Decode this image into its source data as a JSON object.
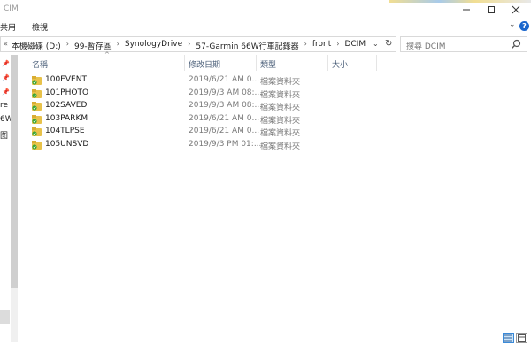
{
  "window": {
    "title": "CIM"
  },
  "ribbon": {
    "tabs": [
      "共用",
      "檢視"
    ]
  },
  "address": {
    "crumbs": [
      "本機磁碟 (D:)",
      "99-暫存區",
      "SynologyDrive",
      "57-Garmin 66W行車記錄器",
      "front",
      "DCIM"
    ]
  },
  "search": {
    "placeholder": "搜尋 DCIM"
  },
  "nav": {
    "labels": [
      "re",
      "6W",
      "图"
    ]
  },
  "columns": {
    "name": "名稱",
    "date": "修改日期",
    "type": "類型",
    "size": "大小"
  },
  "files": [
    {
      "name": "100EVENT",
      "date": "2019/6/21 AM 0...",
      "type": "檔案資料夾"
    },
    {
      "name": "101PHOTO",
      "date": "2019/9/3 AM 08:...",
      "type": "檔案資料夾"
    },
    {
      "name": "102SAVED",
      "date": "2019/9/3 AM 08:...",
      "type": "檔案資料夾"
    },
    {
      "name": "103PARKM",
      "date": "2019/6/21 AM 0...",
      "type": "檔案資料夾"
    },
    {
      "name": "104TLPSE",
      "date": "2019/6/21 AM 0...",
      "type": "檔案資料夾"
    },
    {
      "name": "105UNSVD",
      "date": "2019/9/3 PM 01:...",
      "type": "檔案資料夾"
    }
  ],
  "colors": {
    "folder": "#e8c24a",
    "sync_badge": "#3aa635",
    "header_text": "#4c607a"
  }
}
